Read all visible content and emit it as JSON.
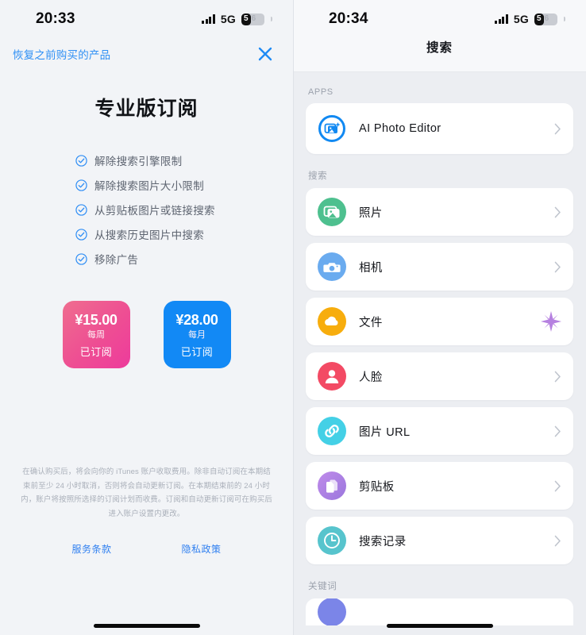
{
  "left": {
    "status": {
      "time": "20:33",
      "network": "5G",
      "battery_level": "5",
      "battery_tail": "6"
    },
    "restore_label": "恢复之前购买的产品",
    "close_icon": "close-icon",
    "title": "专业版订阅",
    "features": [
      "解除搜索引擎限制",
      "解除搜索图片大小限制",
      "从剪贴板图片或链接搜索",
      "从搜索历史图片中搜索",
      "移除广告"
    ],
    "plans": [
      {
        "price": "¥15.00",
        "period": "每周",
        "state": "已订阅",
        "color": "#ee4e93"
      },
      {
        "price": "¥28.00",
        "period": "每月",
        "state": "已订阅",
        "color": "#1289f5"
      }
    ],
    "legal": "在确认购买后，将会向你的 iTunes 账户收取费用。除非自动订阅在本期结束前至少 24 小时取消，否则将会自动更新订阅。在本期结束前的 24 小时内，账户将按照所选择的订阅计划而收费。订阅和自动更新订阅可在购买后进入账户设置内更改。",
    "links": [
      "服务条款",
      "隐私政策"
    ]
  },
  "right": {
    "status": {
      "time": "20:34",
      "network": "5G",
      "battery_level": "5",
      "battery_tail": "6"
    },
    "nav_title": "搜索",
    "sections": [
      {
        "label": "APPS",
        "items": [
          {
            "label": "AI Photo Editor",
            "icon": "ai-photo-editor-icon",
            "accessory": "chevron"
          }
        ]
      },
      {
        "label": "搜索",
        "items": [
          {
            "label": "照片",
            "icon": "photos-icon",
            "accessory": "chevron"
          },
          {
            "label": "相机",
            "icon": "camera-icon",
            "accessory": "chevron"
          },
          {
            "label": "文件",
            "icon": "cloud-files-icon",
            "accessory": "sparkle"
          },
          {
            "label": "人脸",
            "icon": "face-icon",
            "accessory": "chevron"
          },
          {
            "label": "图片 URL",
            "icon": "link-icon",
            "accessory": "chevron"
          },
          {
            "label": "剪贴板",
            "icon": "clipboard-icon",
            "accessory": "chevron"
          },
          {
            "label": "搜索记录",
            "icon": "history-clock-icon",
            "accessory": "chevron"
          }
        ]
      },
      {
        "label": "关键词",
        "items": []
      }
    ]
  }
}
